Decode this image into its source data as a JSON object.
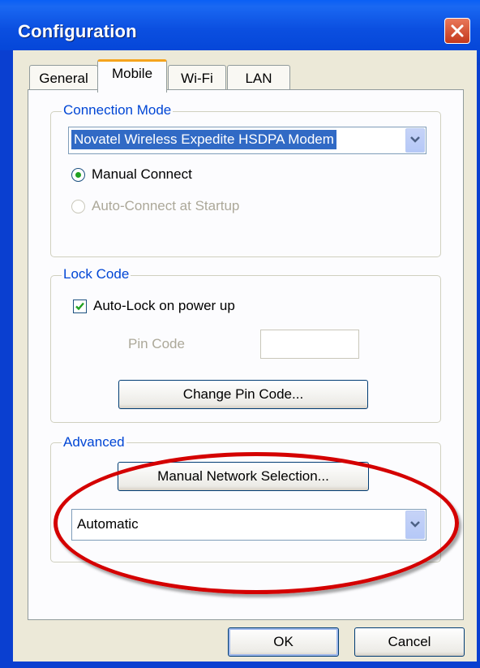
{
  "window": {
    "title": "Configuration"
  },
  "tabs": [
    {
      "label": "General"
    },
    {
      "label": "Mobile"
    },
    {
      "label": "Wi-Fi"
    },
    {
      "label": "LAN"
    }
  ],
  "connection_mode": {
    "group_label": "Connection Mode",
    "device_select_value": "Novatel Wireless Expedite HSDPA Modem",
    "manual_connect_label": "Manual Connect",
    "auto_connect_label": "Auto-Connect at Startup"
  },
  "lock_code": {
    "group_label": "Lock Code",
    "auto_lock_label": "Auto-Lock on power up",
    "pin_code_label": "Pin Code",
    "change_pin_button": "Change Pin Code..."
  },
  "advanced": {
    "group_label": "Advanced",
    "manual_network_button": "Manual Network Selection...",
    "network_select_value": "Automatic"
  },
  "footer": {
    "ok_label": "OK",
    "cancel_label": "Cancel"
  },
  "colors": {
    "annotation": "#d40000",
    "group_label": "#0046d5",
    "selection": "#316ac5"
  }
}
